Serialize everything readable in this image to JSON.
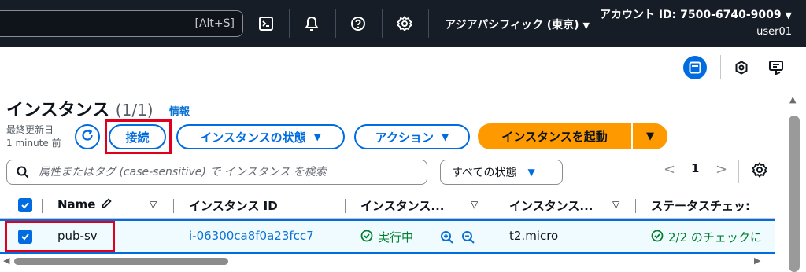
{
  "topbar": {
    "search_shortcut": "[Alt+S]",
    "icons": [
      "cloudshell-icon",
      "bell-icon",
      "help-icon",
      "gear-icon"
    ],
    "region": "アジアパシフィック (東京)",
    "account": "アカウント ID: 7500-6740-9009",
    "user": "user01",
    "caret": "▼"
  },
  "subbar": {
    "icons": [
      "panel-icon",
      "hexagon-icon",
      "feedback-icon"
    ]
  },
  "header": {
    "title": "インスタンス",
    "count": "(1/1)",
    "info": "情報",
    "last_updated_label": "最終更新日",
    "last_updated_value": "1 minute 前"
  },
  "actions": {
    "connect": "接続",
    "instance_state": "インスタンスの状態",
    "action": "アクション",
    "launch": "インスタンスを起動",
    "caret": "▼"
  },
  "filter": {
    "placeholder": "属性またはタグ (case-sensitive) で インスタンス を検索",
    "status_select": "すべての状態"
  },
  "pagination": {
    "prev": "<",
    "page": "1",
    "next": ">"
  },
  "table": {
    "columns": [
      "Name",
      "インスタンス ID",
      "インスタンス...",
      "インスタンス...",
      "ステータスチェッ:"
    ],
    "filter_glyph": "▽",
    "rows": [
      {
        "name": "pub-sv",
        "instance_id": "i-06300ca8f0a23fcc7",
        "state": "実行中",
        "type": "t2.micro",
        "status_check": "2/2 のチェックに"
      }
    ]
  },
  "colors": {
    "topbar_bg": "#161d26",
    "accent_blue": "#006ce0",
    "launch_orange": "#ff9900",
    "success_green": "#00802f",
    "highlight_red": "#e0001b"
  }
}
